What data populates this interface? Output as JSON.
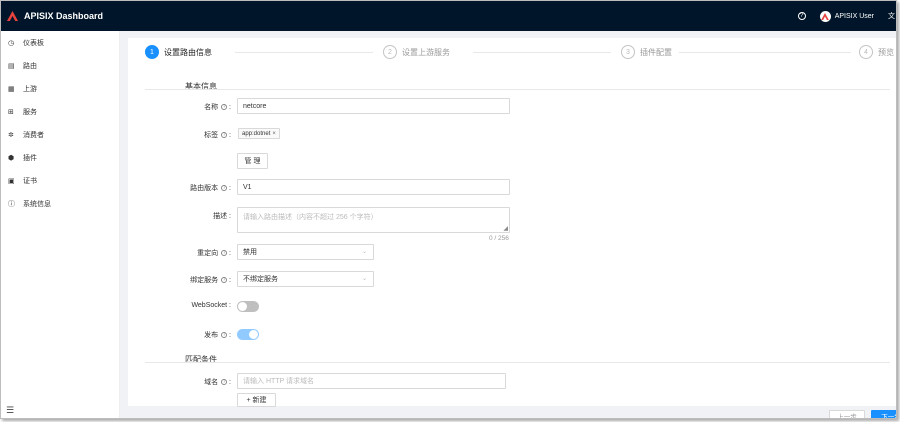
{
  "app": {
    "title": "APISIX Dashboard",
    "user": "APISIX User",
    "lang": "文",
    "help_icon": "question-circle-icon",
    "brand_color": "#e8433e",
    "header_color": "#001529",
    "accent": "#1890ff"
  },
  "sidebar": {
    "items": [
      {
        "label": "仪表板",
        "icon": "dashboard-icon",
        "glyph": "◷"
      },
      {
        "label": "路由",
        "icon": "route-icon",
        "glyph": "▤"
      },
      {
        "label": "上游",
        "icon": "upstream-icon",
        "glyph": "▦"
      },
      {
        "label": "服务",
        "icon": "service-icon",
        "glyph": "⊞"
      },
      {
        "label": "消费者",
        "icon": "consumer-icon",
        "glyph": "✲"
      },
      {
        "label": "插件",
        "icon": "plugin-icon",
        "glyph": "⬢"
      },
      {
        "label": "证书",
        "icon": "certificate-icon",
        "glyph": "▣"
      },
      {
        "label": "系统信息",
        "icon": "info-icon",
        "glyph": "ⓘ"
      }
    ]
  },
  "steps": [
    {
      "num": "1",
      "title": "设置路由信息"
    },
    {
      "num": "2",
      "title": "设置上游服务"
    },
    {
      "num": "3",
      "title": "插件配置"
    },
    {
      "num": "4",
      "title": "预览"
    }
  ],
  "basic": {
    "section_title": "基本信息",
    "name_label": "名称",
    "name_value": "netcore",
    "labels_label": "标签",
    "tag": "app:dotnet",
    "manage_button": "管 理",
    "version_label": "路由版本",
    "version_value": "V1",
    "desc_label": "描述",
    "desc_placeholder": "请输入路由描述（内容不超过 256 个字符）",
    "desc_counter": "0 / 256",
    "redirect_label": "重定向",
    "redirect_value": "禁用",
    "service_label": "绑定服务",
    "service_value": "不绑定服务",
    "websocket_label": "WebSocket",
    "websocket_on": false,
    "publish_label": "发布",
    "publish_on": true
  },
  "match": {
    "section_title": "匹配条件",
    "domain_label": "域名",
    "domain_placeholder": "请输入 HTTP 请求域名",
    "add_button": "+ 新建"
  },
  "footer": {
    "prev_button": "上一步",
    "next_button": "下一步"
  }
}
